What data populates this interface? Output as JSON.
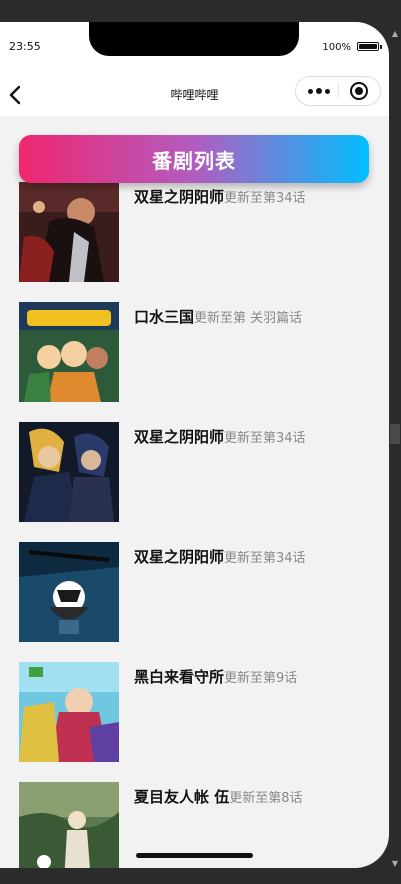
{
  "status": {
    "time": "23:55",
    "battery": "100%"
  },
  "navbar": {
    "title": "哔哩哔哩"
  },
  "header": {
    "title": "番剧列表"
  },
  "items": [
    {
      "name": "双星之阴阳师",
      "update": "更新至第34话"
    },
    {
      "name": "口水三国",
      "update": "更新至第 关羽篇话"
    },
    {
      "name": "双星之阴阳师",
      "update": "更新至第34话"
    },
    {
      "name": "双星之阴阳师",
      "update": "更新至第34话"
    },
    {
      "name": "黑白来看守所",
      "update": "更新至第9话"
    },
    {
      "name": "夏目友人帐 伍",
      "update": "更新至第8话"
    }
  ],
  "colors": {
    "header_gradient_start": "#f0266f",
    "header_gradient_end": "#00bfff",
    "title_text": "#111111",
    "update_text": "#888888"
  }
}
